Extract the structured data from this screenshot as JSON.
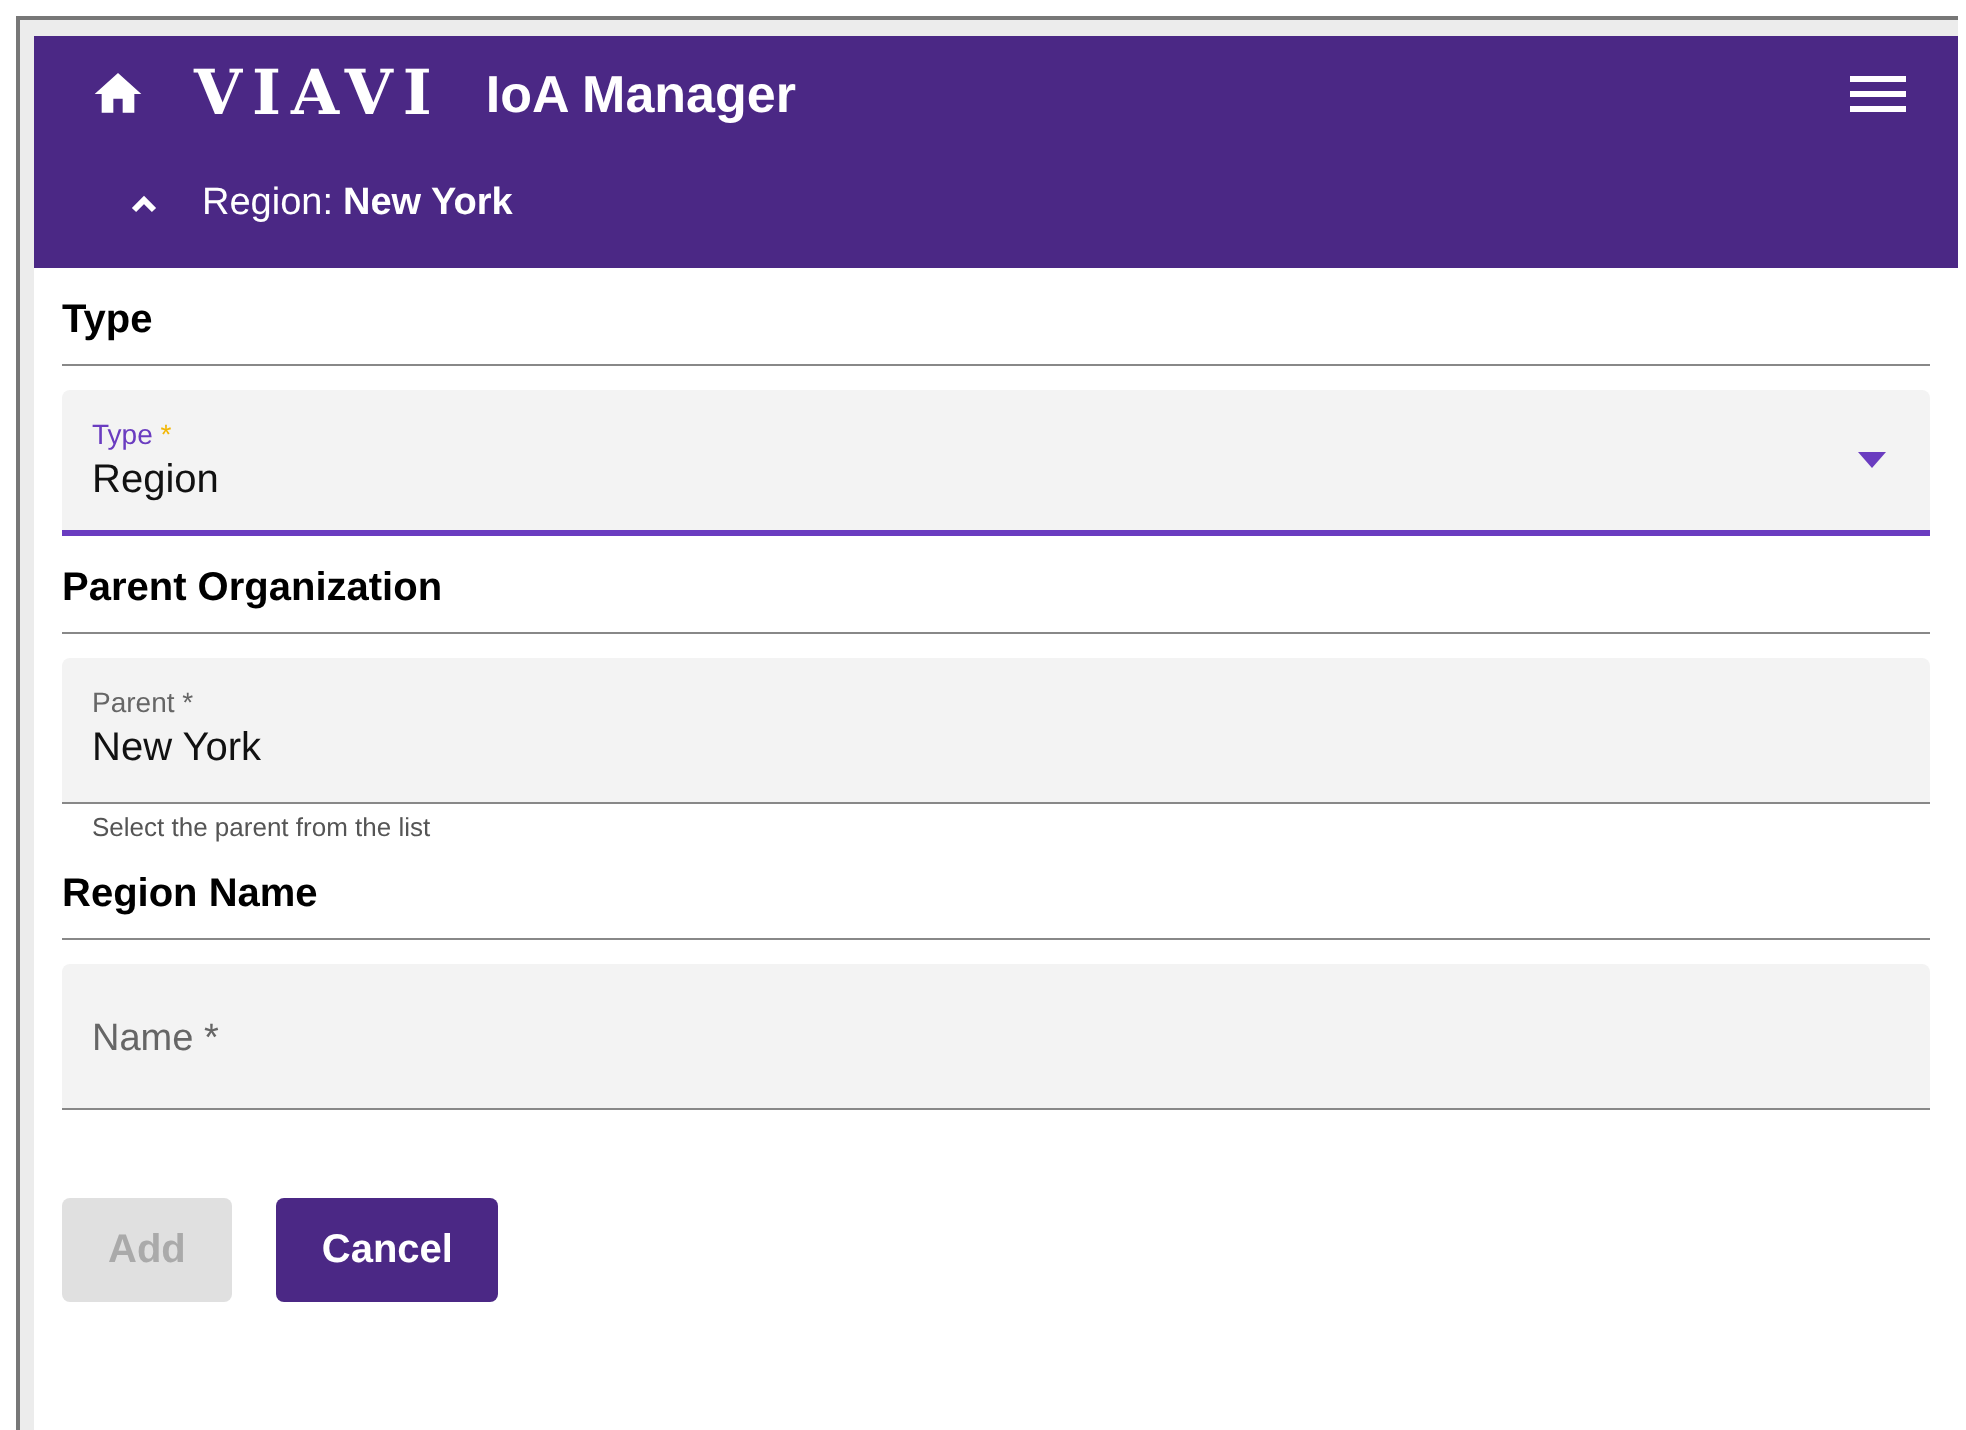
{
  "header": {
    "logo": "VIAVI",
    "title": "IoA Manager",
    "breadcrumb": {
      "label": "Region:",
      "value": "New York",
      "expanded": true
    }
  },
  "sections": [
    {
      "heading": "Type",
      "field": {
        "kind": "select",
        "label": "Type",
        "required_mark": "*",
        "value": "Region",
        "focused": true
      }
    },
    {
      "heading": "Parent Organization",
      "field": {
        "kind": "text",
        "label": "Parent",
        "required_mark": "*",
        "value": "New York",
        "focused": false,
        "helper": "Select the parent from the list"
      }
    },
    {
      "heading": "Region Name",
      "field": {
        "kind": "text",
        "label": "Name",
        "required_mark": "*",
        "focused": false
      }
    }
  ],
  "buttons": [
    {
      "label": "Add",
      "disabled": true
    },
    {
      "label": "Cancel",
      "disabled": false
    }
  ]
}
